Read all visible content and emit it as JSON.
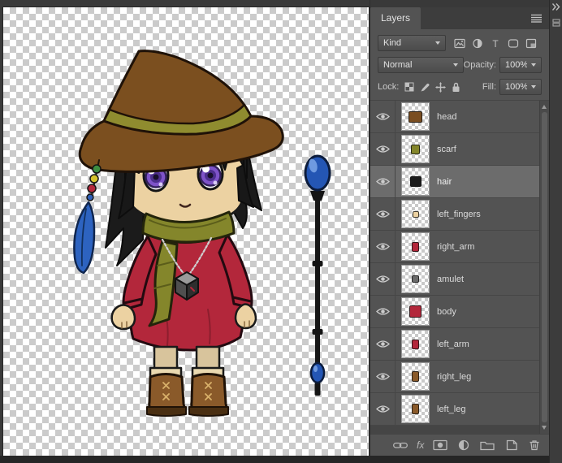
{
  "panel": {
    "tab": "Layers",
    "filter": {
      "kind_label": "Kind",
      "icons": [
        "pixel-filter-icon",
        "adjustment-filter-icon",
        "type-filter-icon",
        "shape-filter-icon",
        "smart-object-filter-icon"
      ]
    },
    "blend": {
      "mode": "Normal",
      "opacity_label": "Opacity:",
      "opacity_value": "100%"
    },
    "lock": {
      "label": "Lock:",
      "icons": [
        "lock-transparency-icon",
        "lock-pixels-icon",
        "lock-position-icon",
        "lock-all-icon"
      ],
      "fill_label": "Fill:",
      "fill_value": "100%"
    },
    "layers": [
      {
        "name": "head",
        "visible": true,
        "selected": false,
        "thumb_color": "#7a4e21",
        "thumb_w": 15,
        "thumb_h": 12
      },
      {
        "name": "scarf",
        "visible": true,
        "selected": false,
        "thumb_color": "#84862b",
        "thumb_w": 9,
        "thumb_h": 10
      },
      {
        "name": "hair",
        "visible": true,
        "selected": true,
        "thumb_color": "#1c1c1c",
        "thumb_w": 12,
        "thumb_h": 11
      },
      {
        "name": "left_fingers",
        "visible": true,
        "selected": false,
        "thumb_color": "#ecd2a2",
        "thumb_w": 6,
        "thumb_h": 6
      },
      {
        "name": "right_arm",
        "visible": true,
        "selected": false,
        "thumb_color": "#b3273b",
        "thumb_w": 7,
        "thumb_h": 10
      },
      {
        "name": "amulet",
        "visible": true,
        "selected": false,
        "thumb_color": "#6a6a6a",
        "thumb_w": 7,
        "thumb_h": 7
      },
      {
        "name": "body",
        "visible": true,
        "selected": false,
        "thumb_color": "#b3273b",
        "thumb_w": 13,
        "thumb_h": 13
      },
      {
        "name": "left_arm",
        "visible": true,
        "selected": false,
        "thumb_color": "#b3273b",
        "thumb_w": 7,
        "thumb_h": 10
      },
      {
        "name": "right_leg",
        "visible": true,
        "selected": false,
        "thumb_color": "#8a5a2a",
        "thumb_w": 7,
        "thumb_h": 11
      },
      {
        "name": "left_leg",
        "visible": true,
        "selected": false,
        "thumb_color": "#8a5a2a",
        "thumb_w": 7,
        "thumb_h": 11
      }
    ],
    "footer": {
      "fx_label": "fx",
      "icons": [
        "link-layers-icon",
        "layer-style-icon",
        "layer-mask-icon",
        "adjustment-layer-icon",
        "new-group-icon",
        "new-layer-icon",
        "delete-layer-icon"
      ]
    }
  },
  "canvas": {
    "description": "chibi witch character with staff on transparent checkerboard",
    "colors": {
      "hat": "#7b4f1f",
      "hat_band": "#8f8c2f",
      "hair": "#1b1b1b",
      "skin": "#ecd2a2",
      "eyes": "#7e53c8",
      "scarf": "#84862b",
      "dress": "#b3273b",
      "boots": "#8a5a2a",
      "staff_orb": "#2456b4",
      "checker_light": "#ffffff",
      "checker_dark": "#cbcbcb"
    }
  },
  "chrome": {
    "panel_bg": "#535353",
    "selected_row": "#6c6c6c"
  }
}
